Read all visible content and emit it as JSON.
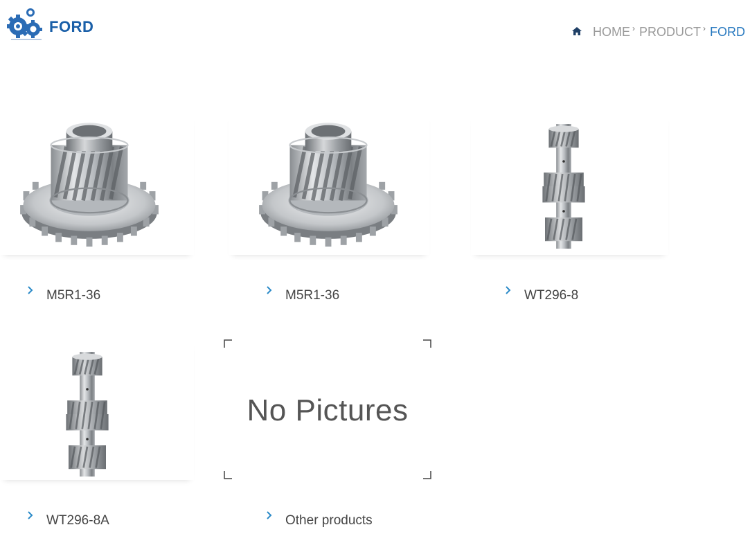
{
  "header": {
    "title": "FORD",
    "logo_icon": "gears-logo-icon",
    "brand_color": "#1a5fa8"
  },
  "breadcrumb": {
    "home_icon": "home-icon",
    "items": [
      "HOME",
      "PRODUCT"
    ],
    "current": "FORD",
    "active_color": "#2a7ac0"
  },
  "products": [
    {
      "name": "M5R1-36",
      "image": "helical-gear-with-spur"
    },
    {
      "name": "M5R1-36",
      "image": "helical-gear-with-spur"
    },
    {
      "name": "WT296-8",
      "image": "cluster-gear-shaft"
    },
    {
      "name": "WT296-8A",
      "image": "cluster-gear-shaft"
    },
    {
      "name": "Other products",
      "image": "no-pictures",
      "placeholder_text": "No Pictures"
    }
  ],
  "accent_color": "#2a8ac8"
}
